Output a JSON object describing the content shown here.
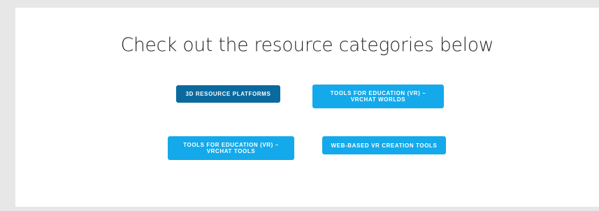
{
  "section": {
    "title": "Check out the resource categories below"
  },
  "buttons": {
    "platforms": {
      "label": "3D RESOURCE PLATFORMS",
      "color": "#0a6a9e"
    },
    "vrchat_worlds": {
      "label": "TOOLS FOR EDUCATION (VR) – VRCHAT WORLDS",
      "color": "#14a9ea"
    },
    "vrchat_tools": {
      "label": "TOOLS FOR EDUCATION (VR) – VRCHAT TOOLS",
      "color": "#14a9ea"
    },
    "web_vr": {
      "label": "WEB-BASED VR CREATION TOOLS",
      "color": "#14a9ea"
    }
  }
}
